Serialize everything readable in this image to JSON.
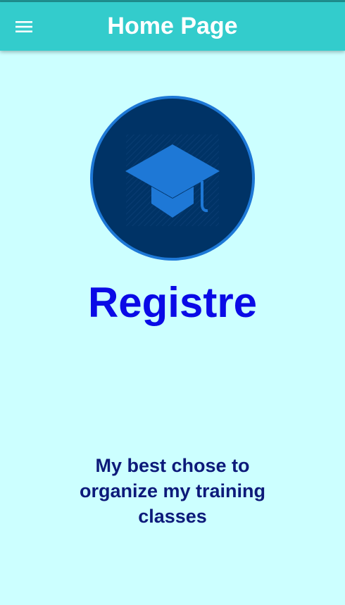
{
  "app_bar": {
    "title": "Home Page",
    "menu_icon": "hamburger-menu-icon",
    "background": "#33cccc"
  },
  "logo": {
    "icon": "graduation-cap-icon",
    "circle_color": "#003366",
    "ring_color": "#1e78d6",
    "cap_color": "#1e78d6"
  },
  "hero": {
    "title": "Registre",
    "tagline": "My best chose to organize my training classes"
  },
  "colors": {
    "page_background": "#ccffff",
    "title_color": "#0a0ae6",
    "tagline_color": "#0d1a7a"
  }
}
